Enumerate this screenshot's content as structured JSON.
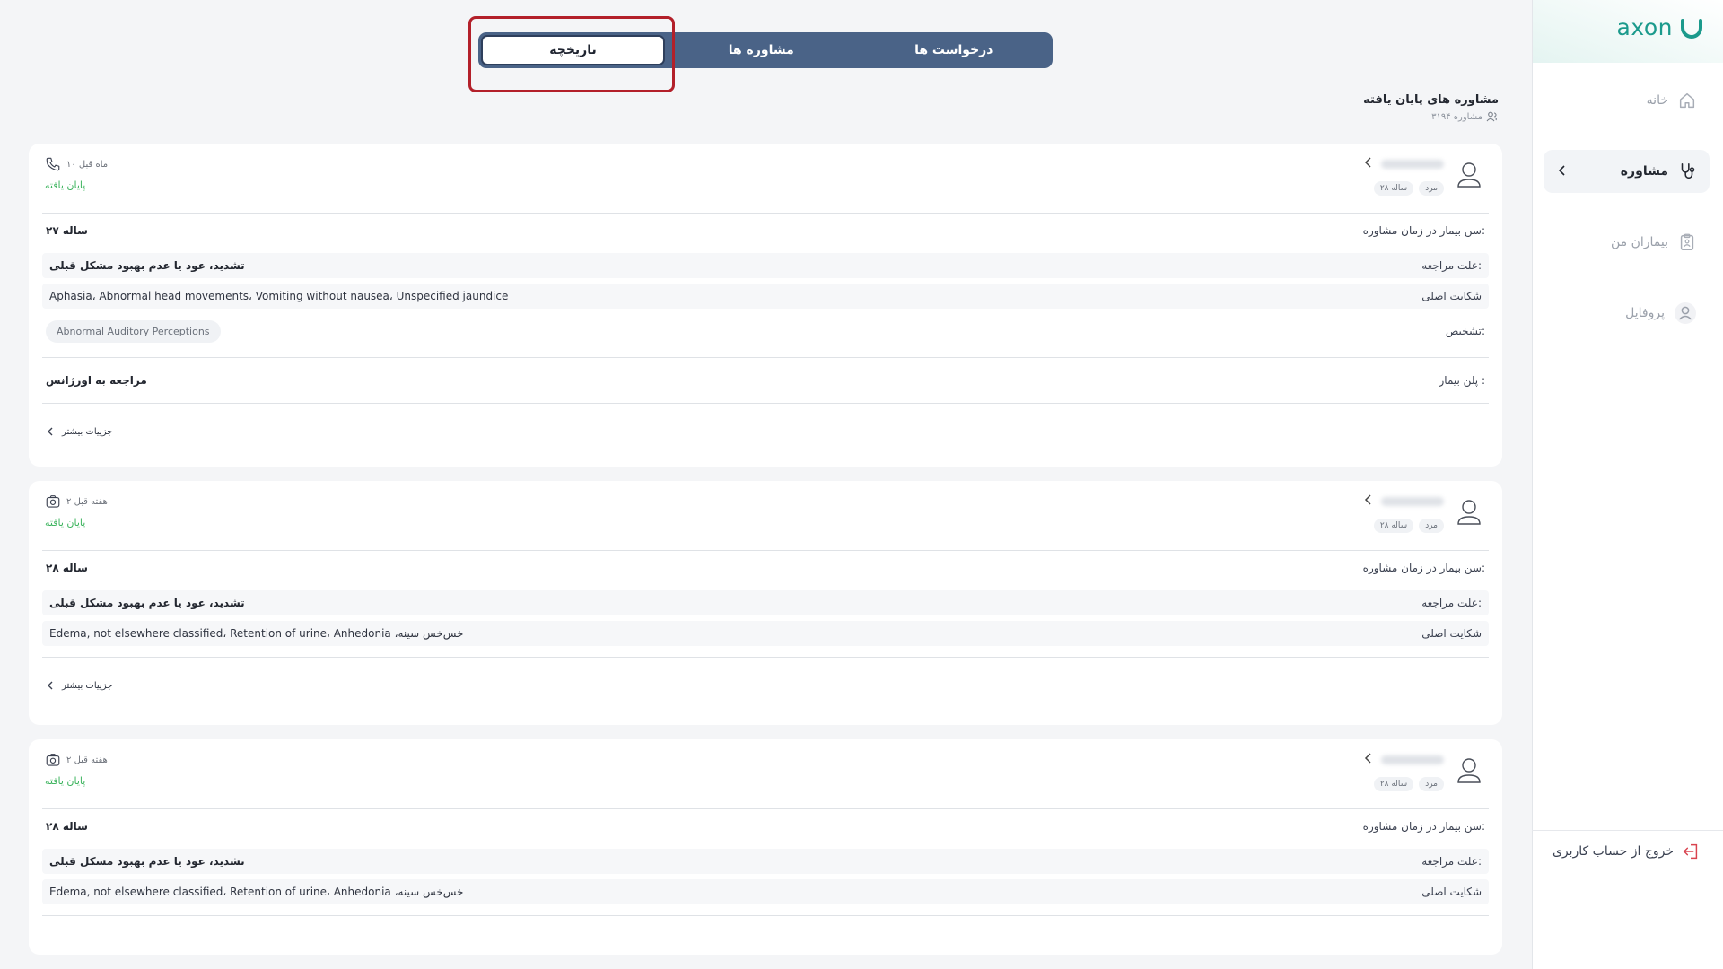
{
  "app": {
    "logo_text": "axon"
  },
  "sidebar": {
    "items": [
      {
        "label": "خانه",
        "icon": "home-icon"
      },
      {
        "label": "مشاوره",
        "icon": "stethoscope-icon",
        "active": true
      },
      {
        "label": "بیماران من",
        "icon": "clipboard-icon"
      },
      {
        "label": "پروفایل",
        "icon": "user-icon"
      }
    ],
    "logout_label": "خروج از حساب کاربری"
  },
  "tabs": [
    {
      "label": "درخواست ها"
    },
    {
      "label": "مشاوره ها"
    },
    {
      "label": "تاریخچه",
      "active": true
    }
  ],
  "section": {
    "title": "مشاوره های پایان یافته",
    "count_text": "۳۱۹۴ مشاوره"
  },
  "labels": {
    "age_at_consult": "سن بیمار در زمان مشاوره:",
    "reason": "علت مراجعه:",
    "chief_complaint": "شکایت اصلی",
    "diagnosis": "تشخیص:",
    "plan": "پلن بیمار :",
    "more_details": "جزییات بیشتر",
    "status_done": "پایان یافته"
  },
  "cards": [
    {
      "gender": "مرد",
      "age_tag": "۲۸ ساله",
      "time": "۱۰ ماه قبل",
      "contact_icon": "phone-icon",
      "age": "۲۷ ساله",
      "reason": "تشدید، عود یا عدم بهبود مشکل قبلی",
      "complaint": "Aphasia، Abnormal head movements، Vomiting without nausea، Unspecified jaundice",
      "diagnosis": "Abnormal Auditory Perceptions",
      "plan": "مراجعه به اورژانس"
    },
    {
      "gender": "مرد",
      "age_tag": "۲۸ ساله",
      "time": "۲ هفته قبل",
      "contact_icon": "camera-icon",
      "age": "۲۸ ساله",
      "reason": "تشدید، عود یا عدم بهبود مشکل قبلی",
      "complaint": "Edema, not elsewhere classified، Retention of urine، Anhedonia ،خس‌خس سینه"
    },
    {
      "gender": "مرد",
      "age_tag": "۲۸ ساله",
      "time": "۲ هفته قبل",
      "contact_icon": "camera-icon",
      "age": "۲۸ ساله",
      "reason": "تشدید، عود یا عدم بهبود مشکل قبلی",
      "complaint": "Edema, not elsewhere classified، Retention of urine، Anhedonia ،خس‌خس سینه"
    }
  ],
  "colors": {
    "accent": "#1b9a8c",
    "tab_bg": "#4a6387",
    "status_green": "#3db45e",
    "highlight": "#b3202a"
  }
}
